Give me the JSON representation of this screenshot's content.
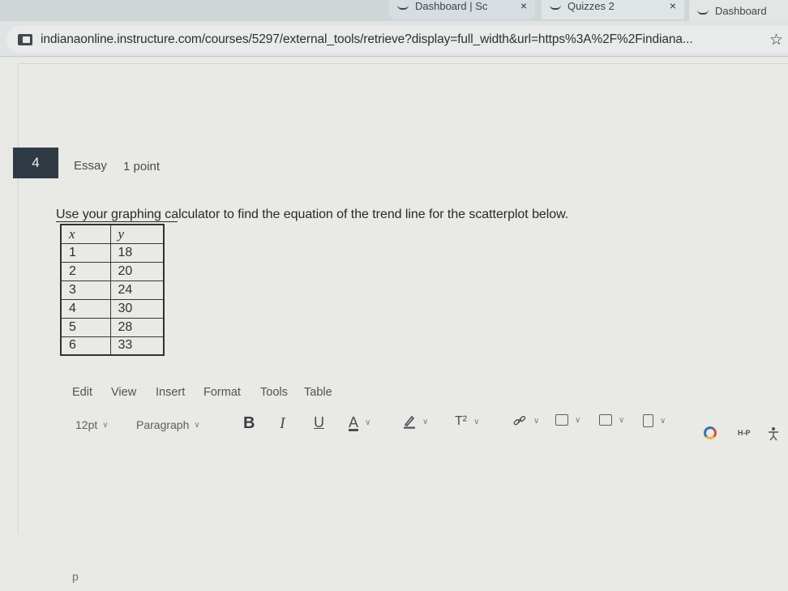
{
  "browser": {
    "tabs": [
      {
        "title": "Dashboard | Sc",
        "close": "×"
      },
      {
        "title": "Quizzes 2",
        "close": "×"
      },
      {
        "title": "Dashboard"
      }
    ],
    "url": "indianaonline.instructure.com/courses/5297/external_tools/retrieve?display=full_width&url=https%3A%2F%2Findiana...",
    "star": "☆"
  },
  "question": {
    "number": "4",
    "type": "Essay",
    "points": "1 point",
    "prompt": "Use your graphing calculator to find the equation of the trend line for the scatterplot below.",
    "table": {
      "headers": [
        "x",
        "y"
      ],
      "rows": [
        [
          "1",
          "18"
        ],
        [
          "2",
          "20"
        ],
        [
          "3",
          "24"
        ],
        [
          "4",
          "30"
        ],
        [
          "5",
          "28"
        ],
        [
          "6",
          "33"
        ]
      ]
    }
  },
  "editor": {
    "menu": [
      "Edit",
      "View",
      "Insert",
      "Format",
      "Tools",
      "Table"
    ],
    "font_size": "12pt",
    "block_format": "Paragraph",
    "buttons": {
      "bold": "B",
      "italic": "I",
      "underline": "U",
      "text_color": "A",
      "superscript": "T²",
      "h5p": "H-P"
    },
    "status_path": "p"
  }
}
